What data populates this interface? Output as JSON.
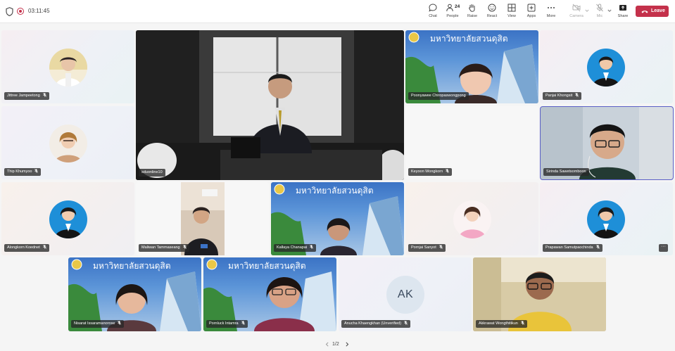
{
  "topbar": {
    "timer": "03:11:45",
    "buttons": [
      {
        "id": "chat",
        "label": "Chat",
        "icon": "chat-icon"
      },
      {
        "id": "people",
        "label": "People",
        "icon": "people-icon",
        "badge": "24"
      },
      {
        "id": "raise",
        "label": "Raise",
        "icon": "hand-icon"
      },
      {
        "id": "react",
        "label": "React",
        "icon": "smiley-icon"
      },
      {
        "id": "view",
        "label": "View",
        "icon": "grid-icon"
      },
      {
        "id": "apps",
        "label": "Apps",
        "icon": "apps-icon"
      },
      {
        "id": "more",
        "label": "More",
        "icon": "ellipsis-icon"
      },
      {
        "id": "camera",
        "label": "Camera",
        "icon": "camera-off-icon"
      },
      {
        "id": "mic",
        "label": "Mic",
        "icon": "mic-off-icon"
      },
      {
        "id": "share",
        "label": "Share",
        "icon": "share-icon"
      }
    ],
    "leave_label": "Leave"
  },
  "university_banner": "มหาวิทยาลัยสวนดุสิต",
  "participants": [
    {
      "name": "Jittree Jampeetong",
      "muted": true,
      "kind": "avatar"
    },
    {
      "name": "sduonline10",
      "muted": false,
      "kind": "video"
    },
    {
      "name": "Poonyawee Chiropaswongpong",
      "muted": false,
      "kind": "video"
    },
    {
      "name": "Panjai Khongsit",
      "muted": true,
      "kind": "avatar"
    },
    {
      "name": "Thip Khumyoo",
      "muted": true,
      "kind": "avatar"
    },
    {
      "name": "Keyoon Wongkorn",
      "muted": true,
      "kind": "blank"
    },
    {
      "name": "Sirinda Sawetsomboon",
      "muted": false,
      "kind": "video",
      "selected": true
    },
    {
      "name": "Alongkorn Koednet",
      "muted": true,
      "kind": "avatar"
    },
    {
      "name": "Maliwan Tammaseang",
      "muted": true,
      "kind": "video"
    },
    {
      "name": "Kallaya Chanapai",
      "muted": true,
      "kind": "video"
    },
    {
      "name": "Pornjai Sanyot",
      "muted": true,
      "kind": "avatar"
    },
    {
      "name": "Prapawan Samutpaochinda",
      "muted": true,
      "kind": "avatar"
    },
    {
      "name": "Nisarat Issaramanorose",
      "muted": true,
      "kind": "video"
    },
    {
      "name": "Pornluck Intamra",
      "muted": true,
      "kind": "video"
    },
    {
      "name": "Anucha Khaengkhan (Unverified)",
      "muted": true,
      "kind": "initials",
      "initials": "AK"
    },
    {
      "name": "Akkrawat Wongthitikun",
      "muted": true,
      "kind": "video"
    }
  ],
  "pager": {
    "label": "1/2"
  },
  "colors": {
    "leave": "#c4314b",
    "selected_outline": "#5b5fc7",
    "nametag_bg": "#282828"
  }
}
